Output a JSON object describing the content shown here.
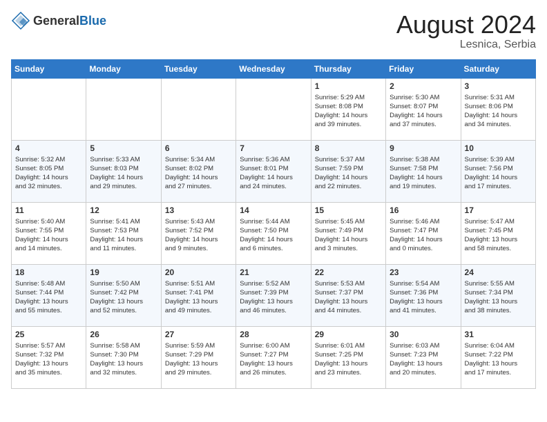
{
  "header": {
    "logo": {
      "general": "General",
      "blue": "Blue"
    },
    "title": "August 2024",
    "location": "Lesnica, Serbia"
  },
  "days_of_week": [
    "Sunday",
    "Monday",
    "Tuesday",
    "Wednesday",
    "Thursday",
    "Friday",
    "Saturday"
  ],
  "weeks": [
    [
      {
        "day": "",
        "info": ""
      },
      {
        "day": "",
        "info": ""
      },
      {
        "day": "",
        "info": ""
      },
      {
        "day": "",
        "info": ""
      },
      {
        "day": "1",
        "info": "Sunrise: 5:29 AM\nSunset: 8:08 PM\nDaylight: 14 hours\nand 39 minutes."
      },
      {
        "day": "2",
        "info": "Sunrise: 5:30 AM\nSunset: 8:07 PM\nDaylight: 14 hours\nand 37 minutes."
      },
      {
        "day": "3",
        "info": "Sunrise: 5:31 AM\nSunset: 8:06 PM\nDaylight: 14 hours\nand 34 minutes."
      }
    ],
    [
      {
        "day": "4",
        "info": "Sunrise: 5:32 AM\nSunset: 8:05 PM\nDaylight: 14 hours\nand 32 minutes."
      },
      {
        "day": "5",
        "info": "Sunrise: 5:33 AM\nSunset: 8:03 PM\nDaylight: 14 hours\nand 29 minutes."
      },
      {
        "day": "6",
        "info": "Sunrise: 5:34 AM\nSunset: 8:02 PM\nDaylight: 14 hours\nand 27 minutes."
      },
      {
        "day": "7",
        "info": "Sunrise: 5:36 AM\nSunset: 8:01 PM\nDaylight: 14 hours\nand 24 minutes."
      },
      {
        "day": "8",
        "info": "Sunrise: 5:37 AM\nSunset: 7:59 PM\nDaylight: 14 hours\nand 22 minutes."
      },
      {
        "day": "9",
        "info": "Sunrise: 5:38 AM\nSunset: 7:58 PM\nDaylight: 14 hours\nand 19 minutes."
      },
      {
        "day": "10",
        "info": "Sunrise: 5:39 AM\nSunset: 7:56 PM\nDaylight: 14 hours\nand 17 minutes."
      }
    ],
    [
      {
        "day": "11",
        "info": "Sunrise: 5:40 AM\nSunset: 7:55 PM\nDaylight: 14 hours\nand 14 minutes."
      },
      {
        "day": "12",
        "info": "Sunrise: 5:41 AM\nSunset: 7:53 PM\nDaylight: 14 hours\nand 11 minutes."
      },
      {
        "day": "13",
        "info": "Sunrise: 5:43 AM\nSunset: 7:52 PM\nDaylight: 14 hours\nand 9 minutes."
      },
      {
        "day": "14",
        "info": "Sunrise: 5:44 AM\nSunset: 7:50 PM\nDaylight: 14 hours\nand 6 minutes."
      },
      {
        "day": "15",
        "info": "Sunrise: 5:45 AM\nSunset: 7:49 PM\nDaylight: 14 hours\nand 3 minutes."
      },
      {
        "day": "16",
        "info": "Sunrise: 5:46 AM\nSunset: 7:47 PM\nDaylight: 14 hours\nand 0 minutes."
      },
      {
        "day": "17",
        "info": "Sunrise: 5:47 AM\nSunset: 7:45 PM\nDaylight: 13 hours\nand 58 minutes."
      }
    ],
    [
      {
        "day": "18",
        "info": "Sunrise: 5:48 AM\nSunset: 7:44 PM\nDaylight: 13 hours\nand 55 minutes."
      },
      {
        "day": "19",
        "info": "Sunrise: 5:50 AM\nSunset: 7:42 PM\nDaylight: 13 hours\nand 52 minutes."
      },
      {
        "day": "20",
        "info": "Sunrise: 5:51 AM\nSunset: 7:41 PM\nDaylight: 13 hours\nand 49 minutes."
      },
      {
        "day": "21",
        "info": "Sunrise: 5:52 AM\nSunset: 7:39 PM\nDaylight: 13 hours\nand 46 minutes."
      },
      {
        "day": "22",
        "info": "Sunrise: 5:53 AM\nSunset: 7:37 PM\nDaylight: 13 hours\nand 44 minutes."
      },
      {
        "day": "23",
        "info": "Sunrise: 5:54 AM\nSunset: 7:36 PM\nDaylight: 13 hours\nand 41 minutes."
      },
      {
        "day": "24",
        "info": "Sunrise: 5:55 AM\nSunset: 7:34 PM\nDaylight: 13 hours\nand 38 minutes."
      }
    ],
    [
      {
        "day": "25",
        "info": "Sunrise: 5:57 AM\nSunset: 7:32 PM\nDaylight: 13 hours\nand 35 minutes."
      },
      {
        "day": "26",
        "info": "Sunrise: 5:58 AM\nSunset: 7:30 PM\nDaylight: 13 hours\nand 32 minutes."
      },
      {
        "day": "27",
        "info": "Sunrise: 5:59 AM\nSunset: 7:29 PM\nDaylight: 13 hours\nand 29 minutes."
      },
      {
        "day": "28",
        "info": "Sunrise: 6:00 AM\nSunset: 7:27 PM\nDaylight: 13 hours\nand 26 minutes."
      },
      {
        "day": "29",
        "info": "Sunrise: 6:01 AM\nSunset: 7:25 PM\nDaylight: 13 hours\nand 23 minutes."
      },
      {
        "day": "30",
        "info": "Sunrise: 6:03 AM\nSunset: 7:23 PM\nDaylight: 13 hours\nand 20 minutes."
      },
      {
        "day": "31",
        "info": "Sunrise: 6:04 AM\nSunset: 7:22 PM\nDaylight: 13 hours\nand 17 minutes."
      }
    ]
  ]
}
